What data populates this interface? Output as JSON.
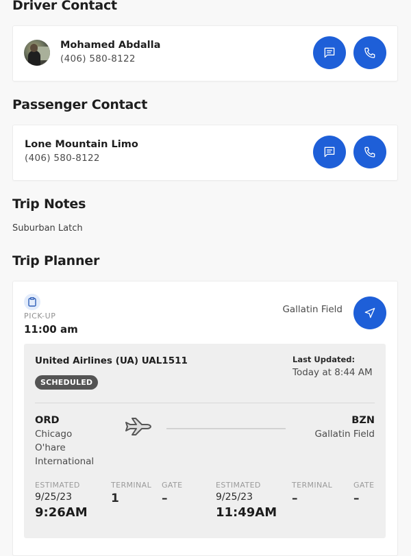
{
  "driver_contact": {
    "title": "Driver Contact",
    "name": "Mohamed Abdalla",
    "phone": "(406) 580-8122"
  },
  "passenger_contact": {
    "title": "Passenger Contact",
    "name": "Lone Mountain Limo",
    "phone": "(406) 580-8122"
  },
  "trip_notes": {
    "title": "Trip Notes",
    "text": "Suburban Latch"
  },
  "trip_planner": {
    "title": "Trip Planner",
    "pickup": {
      "label": "PICK-UP",
      "time": "11:00 am",
      "location": "Gallatin Field"
    },
    "flight": {
      "airline": "United Airlines (UA) UAL1511",
      "status": "SCHEDULED",
      "last_updated_label": "Last Updated:",
      "last_updated_value": "Today at 8:44 AM",
      "origin": {
        "code": "ORD",
        "place_lines": [
          "Chicago",
          "O'hare",
          "International"
        ],
        "estimated_label": "ESTIMATED",
        "date": "9/25/23",
        "time": "9:26AM",
        "terminal_label": "TERMINAL",
        "terminal": "1",
        "gate_label": "GATE",
        "gate": "–"
      },
      "destination": {
        "code": "BZN",
        "place": "Gallatin Field",
        "estimated_label": "ESTIMATED",
        "date": "9/25/23",
        "time": "11:49AM",
        "terminal_label": "TERMINAL",
        "terminal": "–",
        "gate_label": "GATE",
        "gate": "–"
      }
    }
  },
  "colors": {
    "accent": "#1e5fd8",
    "status_pill": "#545454",
    "flight_box": "#efefef"
  }
}
